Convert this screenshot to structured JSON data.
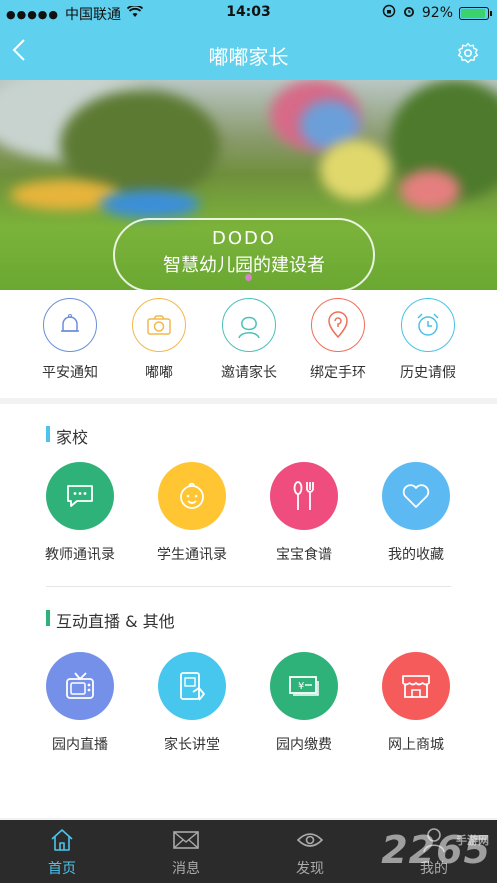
{
  "status": {
    "carrier": "中国联通",
    "time": "14:03",
    "battery": "92%",
    "battery_level": 0.92
  },
  "nav": {
    "title": "嘟嘟家长"
  },
  "banner": {
    "title_en": "DODO",
    "subtitle": "智慧幼儿园的建设者"
  },
  "quick": [
    {
      "label": "平安通知",
      "icon": "bell-icon",
      "color": "#6a8fd8"
    },
    {
      "label": "嘟嘟",
      "icon": "camera-icon",
      "color": "#f2b84b"
    },
    {
      "label": "邀请家长",
      "icon": "person-icon",
      "color": "#4cc0b8"
    },
    {
      "label": "绑定手环",
      "icon": "bracelet-icon",
      "color": "#ef6f5a"
    },
    {
      "label": "历史请假",
      "icon": "alarm-clock-icon",
      "color": "#4bc2e6"
    }
  ],
  "school": {
    "title": "家校",
    "items": [
      {
        "label": "教师通讯录",
        "icon": "chat-icon",
        "color": "#2fb27a"
      },
      {
        "label": "学生通讯录",
        "icon": "baby-face-icon",
        "color": "#ffc533"
      },
      {
        "label": "宝宝食谱",
        "icon": "spoon-fork-icon",
        "color": "#ee4d7e"
      },
      {
        "label": "我的收藏",
        "icon": "heart-icon",
        "color": "#5cb9f2"
      }
    ]
  },
  "other": {
    "title": "互动直播 & 其他",
    "items": [
      {
        "label": "园内直播",
        "icon": "tv-icon",
        "color": "#7590e8"
      },
      {
        "label": "家长讲堂",
        "icon": "tablet-icon",
        "color": "#47c7ee"
      },
      {
        "label": "园内缴费",
        "icon": "money-icon",
        "color": "#2fb27a"
      },
      {
        "label": "网上商城",
        "icon": "shop-icon",
        "color": "#f65b5b"
      }
    ]
  },
  "tabs": [
    {
      "label": "首页",
      "icon": "home-icon",
      "active": true
    },
    {
      "label": "消息",
      "icon": "mail-icon",
      "active": false
    },
    {
      "label": "发现",
      "icon": "eye-icon",
      "active": false
    },
    {
      "label": "我的",
      "icon": "user-icon",
      "active": false
    }
  ],
  "watermark": {
    "big": "2265",
    "small": "手游网"
  },
  "colors": {
    "primary": "#5fd0ee",
    "tabbar": "#2b2b2b",
    "active_tab": "#4cc4ea"
  }
}
